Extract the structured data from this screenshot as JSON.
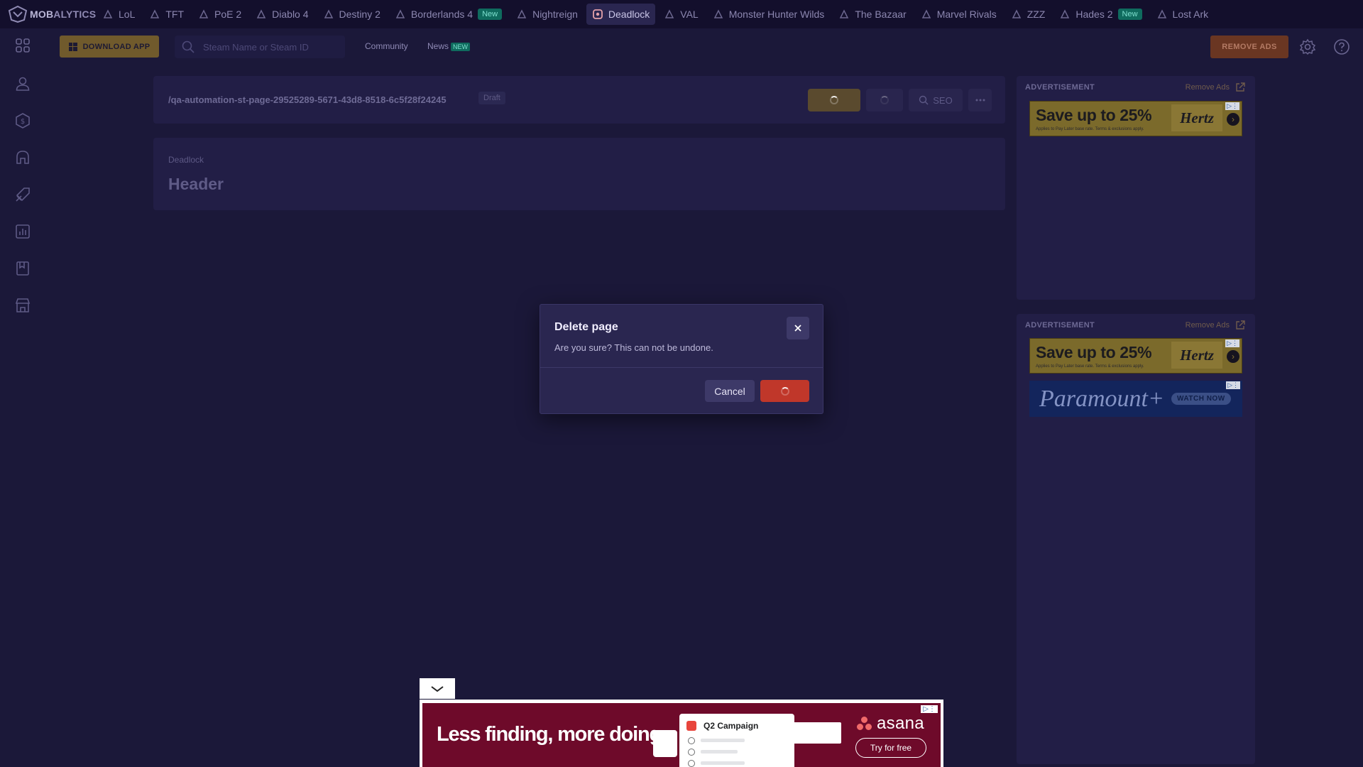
{
  "topbar": {
    "logo": {
      "part1": "MOB",
      "part2": "ALYTICS"
    },
    "games": [
      {
        "label": "LoL",
        "icon": "lol-icon"
      },
      {
        "label": "TFT",
        "icon": "tft-icon"
      },
      {
        "label": "PoE 2",
        "icon": "poe2-icon"
      },
      {
        "label": "Diablo 4",
        "icon": "diablo4-icon"
      },
      {
        "label": "Destiny 2",
        "icon": "destiny2-icon"
      },
      {
        "label": "Borderlands 4",
        "icon": "borderlands4-icon",
        "badge": "New"
      },
      {
        "label": "Nightreign",
        "icon": "nightreign-icon"
      },
      {
        "label": "Deadlock",
        "icon": "deadlock-icon",
        "active": true
      },
      {
        "label": "VAL",
        "icon": "valorant-icon"
      },
      {
        "label": "Monster Hunter Wilds",
        "icon": "mhw-icon"
      },
      {
        "label": "The Bazaar",
        "icon": "bazaar-icon"
      },
      {
        "label": "Marvel Rivals",
        "icon": "marvel-rivals-icon"
      },
      {
        "label": "ZZZ",
        "icon": "zzz-icon"
      },
      {
        "label": "Hades 2",
        "icon": "hades2-icon",
        "badge": "New"
      },
      {
        "label": "Lost Ark",
        "icon": "lost-ark-icon"
      }
    ]
  },
  "subbar": {
    "download_label": "DOWNLOAD APP",
    "search_placeholder": "Steam Name or Steam ID",
    "community_label": "Community",
    "news_label": "News",
    "news_badge": "NEW",
    "remove_ads_label": "REMOVE ADS"
  },
  "sidebar": {
    "icons": [
      "profile-icon",
      "builds-icon",
      "heroes-icon",
      "tier-list-icon",
      "stats-icon",
      "guides-icon",
      "store-icon"
    ]
  },
  "page": {
    "path": "/qa-automation-st-page-29525289-5671-43d8-8518-6c5f28f24245",
    "status": "Draft",
    "seo_label": "SEO",
    "game_label": "Deadlock",
    "header_title": "Header"
  },
  "ads": {
    "label": "ADVERTISEMENT",
    "remove_label": "Remove Ads",
    "hertz": {
      "headline": "Save up to 25%",
      "fine_print": "Applies to Pay Later base rate. Terms & exclusions apply.",
      "brand": "Hertz"
    },
    "paramount": {
      "brand": "Paramount+",
      "cta": "WATCH NOW"
    },
    "bottom": {
      "headline": "Less finding, more doing",
      "card_title": "Q2 Campaign",
      "brand": "asana",
      "cta": "Try for free"
    }
  },
  "modal": {
    "title": "Delete page",
    "message": "Are you sure? This can not be undone.",
    "cancel_label": "Cancel"
  },
  "colors": {
    "background": "#1b1839",
    "card": "#221e46",
    "danger": "#c0372a",
    "accent": "#705a2c"
  }
}
